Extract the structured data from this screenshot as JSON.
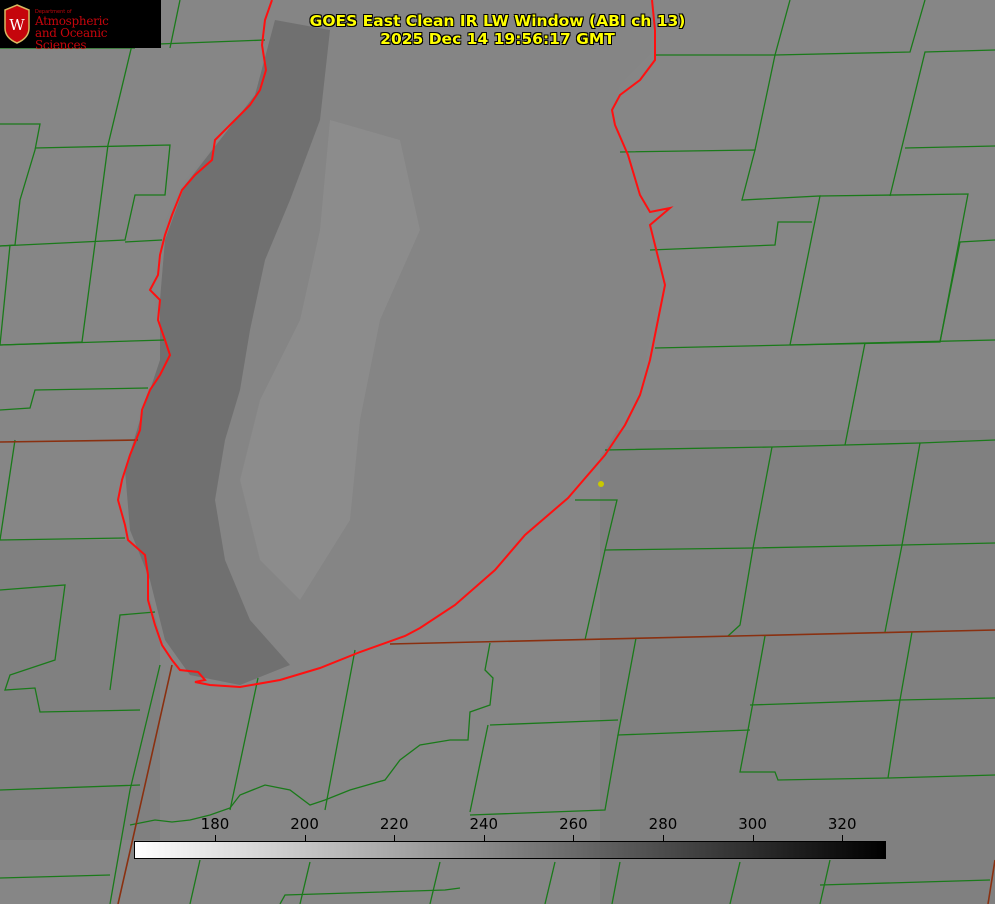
{
  "logo": {
    "department": "Department of",
    "name_line1": "Atmospheric",
    "name_line2": "and Oceanic Sciences",
    "seal_letter": "W",
    "brand_color": "#c5050c"
  },
  "title": {
    "line1": "GOES East Clean IR LW Window (ABI ch 13)",
    "line2": "2025 Dec 14 19:56:17 GMT",
    "color": "#ffff00"
  },
  "colorbar": {
    "ticks": [
      "180",
      "200",
      "220",
      "240",
      "260",
      "280",
      "300",
      "320"
    ],
    "start_color": "#ffffff",
    "end_color": "#000000"
  },
  "map": {
    "background_color": "#848484",
    "lake_color": "#7a7a7a",
    "county_line_color": "#1a7a1a",
    "coastline_color": "#ff1010",
    "state_line_color": "#8a3010",
    "marker_color": "#c8c800"
  }
}
